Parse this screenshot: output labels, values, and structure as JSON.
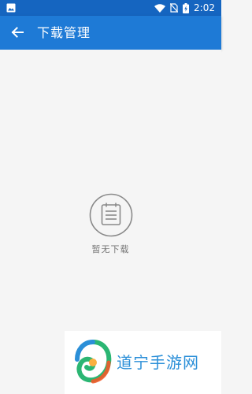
{
  "status_bar": {
    "time": "2:02",
    "icons": [
      "image-icon",
      "wifi-icon",
      "no-sim-icon",
      "battery-charging-icon"
    ],
    "color": "#1565c0"
  },
  "app_bar": {
    "title": "下载管理",
    "back_icon": "back-arrow-icon",
    "color": "#1e7ad6"
  },
  "empty_state": {
    "icon": "document-list-icon",
    "text": "暂无下载"
  },
  "watermark": {
    "text": "道宁手游网",
    "logo": "swirl-logo"
  }
}
